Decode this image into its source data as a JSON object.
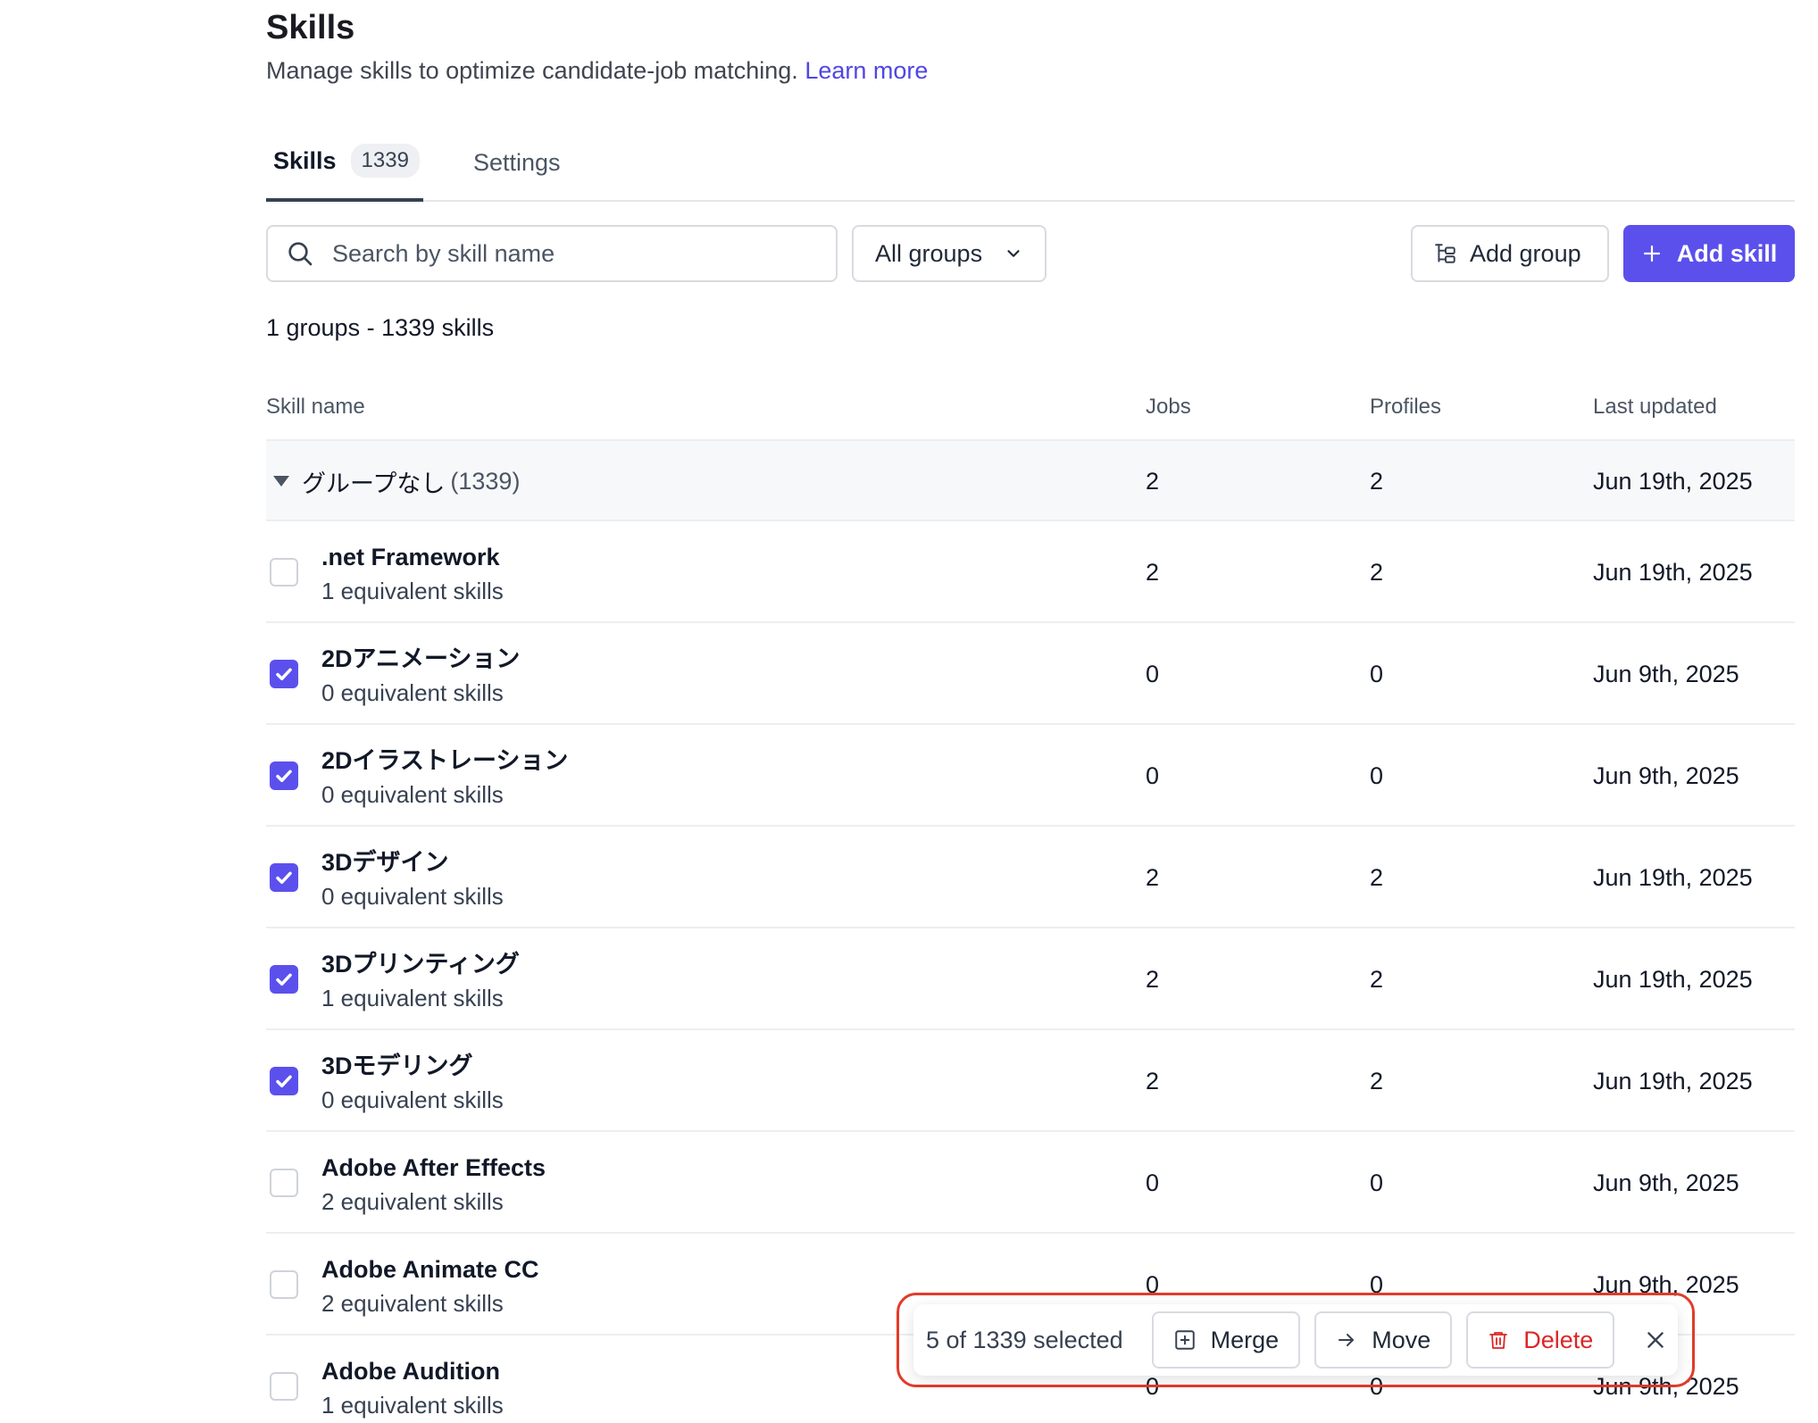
{
  "header": {
    "title": "Skills",
    "subtitle": "Manage skills to optimize candidate-job matching.",
    "learn_more": "Learn more"
  },
  "tabs": [
    {
      "label": "Skills",
      "count": "1339",
      "active": true
    },
    {
      "label": "Settings",
      "active": false
    }
  ],
  "toolbar": {
    "search_placeholder": "Search by skill name",
    "group_filter": "All groups",
    "add_group": "Add group",
    "add_skill": "Add skill",
    "icons": [
      "search-icon",
      "chevron-down-icon",
      "group-icon",
      "plus-icon"
    ],
    "accent": "#5b50ec"
  },
  "summary": "1 groups - 1339 skills",
  "table": {
    "columns": [
      "Skill name",
      "Jobs",
      "Profiles",
      "Last updated"
    ],
    "group": {
      "name": "グループなし",
      "count": "(1339)",
      "jobs": "2",
      "profiles": "2",
      "updated": "Jun 19th, 2025"
    },
    "rows": [
      {
        "name": ".net Framework",
        "equiv": "1 equivalent skills",
        "jobs": "2",
        "profiles": "2",
        "updated": "Jun 19th, 2025",
        "checked": false
      },
      {
        "name": "2Dアニメーション",
        "equiv": "0 equivalent skills",
        "jobs": "0",
        "profiles": "0",
        "updated": "Jun 9th, 2025",
        "checked": true
      },
      {
        "name": "2Dイラストレーション",
        "equiv": "0 equivalent skills",
        "jobs": "0",
        "profiles": "0",
        "updated": "Jun 9th, 2025",
        "checked": true
      },
      {
        "name": "3Dデザイン",
        "equiv": "0 equivalent skills",
        "jobs": "2",
        "profiles": "2",
        "updated": "Jun 19th, 2025",
        "checked": true
      },
      {
        "name": "3Dプリンティング",
        "equiv": "1 equivalent skills",
        "jobs": "2",
        "profiles": "2",
        "updated": "Jun 19th, 2025",
        "checked": true
      },
      {
        "name": "3Dモデリング",
        "equiv": "0 equivalent skills",
        "jobs": "2",
        "profiles": "2",
        "updated": "Jun 19th, 2025",
        "checked": true
      },
      {
        "name": "Adobe After Effects",
        "equiv": "2 equivalent skills",
        "jobs": "0",
        "profiles": "0",
        "updated": "Jun 9th, 2025",
        "checked": false
      },
      {
        "name": "Adobe Animate CC",
        "equiv": "2 equivalent skills",
        "jobs": "0",
        "profiles": "0",
        "updated": "Jun 9th, 2025",
        "checked": false
      },
      {
        "name": "Adobe Audition",
        "equiv": "1 equivalent skills",
        "jobs": "0",
        "profiles": "0",
        "updated": "Jun 9th, 2025",
        "checked": false
      }
    ]
  },
  "selection_bar": {
    "text": "5 of 1339 selected",
    "merge": "Merge",
    "move": "Move",
    "delete": "Delete",
    "highlight_color": "#e23b2a",
    "danger_color": "#dc2626"
  }
}
